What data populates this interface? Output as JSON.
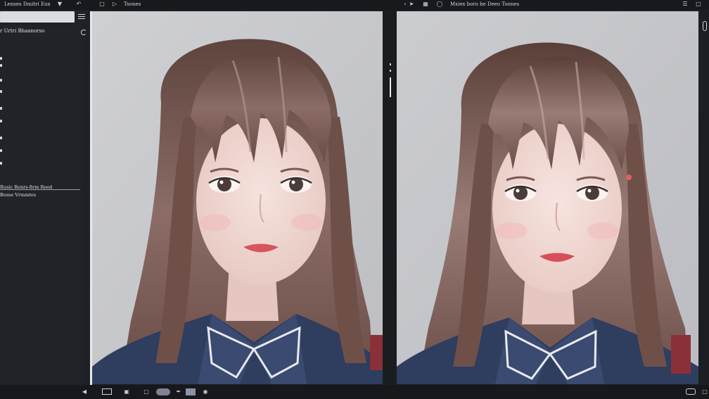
{
  "topbar": {
    "title": "Lenses Dmitri Eux",
    "tab_label": "Tsones",
    "compare_label": "Mxiex boro be Deeo Toones"
  },
  "left_panel": {
    "heading": "r Urtri Bhaanorso",
    "label_one": "Rusic Renrs-firm Reed",
    "label_two": "Bosse Vrmmtes"
  },
  "portrait": {
    "hair": "#6f5048",
    "hair_light": "#a88a84",
    "skin": "#f0d9d4",
    "shirt": "#2f3d5f",
    "background": "#c9cacd"
  }
}
